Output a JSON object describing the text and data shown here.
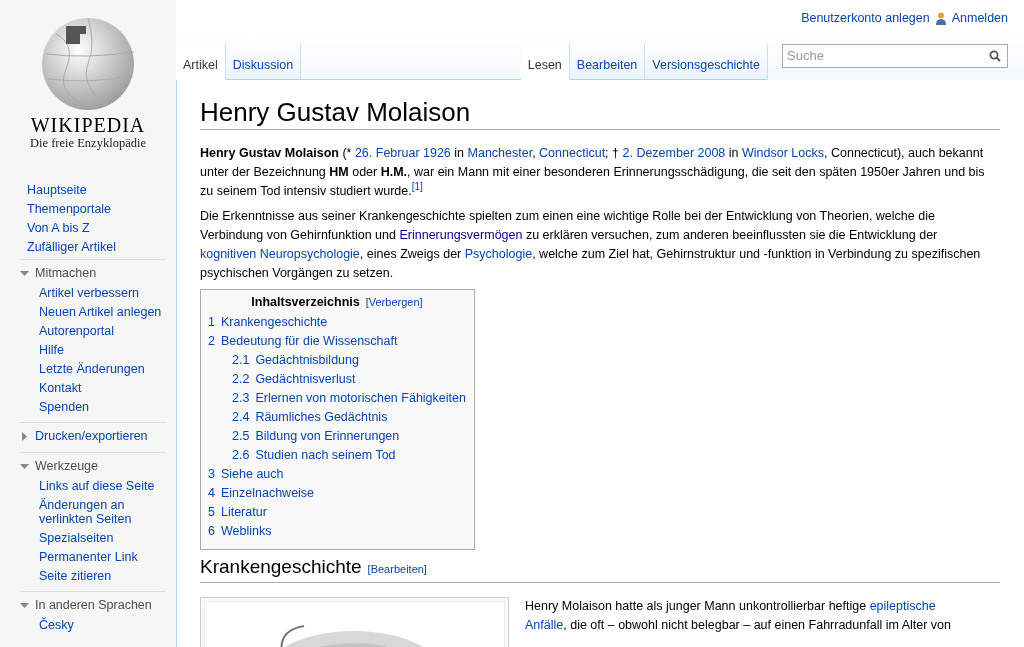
{
  "personal": {
    "create_account": "Benutzerkonto anlegen",
    "login": "Anmelden"
  },
  "logo": {
    "wordmark": "WIKIPEDIA",
    "tagline": "Die freie Enzyklopädie"
  },
  "nav": [
    "Hauptseite",
    "Themenportale",
    "Von A bis Z",
    "Zufälliger Artikel"
  ],
  "portals": [
    {
      "heading": "Mitmachen",
      "expanded": true,
      "items": [
        "Artikel verbessern",
        "Neuen Artikel anlegen",
        "Autorenportal",
        "Hilfe",
        "Letzte Änderungen",
        "Kontakt",
        "Spenden"
      ]
    },
    {
      "heading": "Drucken/exportieren",
      "expanded": false
    },
    {
      "heading": "Werkzeuge",
      "expanded": true,
      "items": [
        "Links auf diese Seite",
        "Änderungen an verlinkten Seiten",
        "Spezialseiten",
        "Permanenter Link",
        "Seite zitieren"
      ]
    },
    {
      "heading": "In anderen Sprachen",
      "expanded": true,
      "items": [
        "Česky"
      ]
    }
  ],
  "namespace_tabs": [
    {
      "label": "Artikel",
      "selected": true
    },
    {
      "label": "Diskussion",
      "selected": false
    }
  ],
  "view_tabs": [
    {
      "label": "Lesen",
      "selected": true
    },
    {
      "label": "Bearbeiten",
      "selected": false
    },
    {
      "label": "Versionsgeschichte",
      "selected": false
    }
  ],
  "search": {
    "placeholder": "Suche"
  },
  "title": "Henry Gustav Molaison",
  "paragraphs": [
    [
      {
        "kind": "bold",
        "text": "Henry Gustav Molaison"
      },
      {
        "kind": "text",
        "text": " (* "
      },
      {
        "kind": "link",
        "text": "26. Februar 1926"
      },
      {
        "kind": "text",
        "text": " in "
      },
      {
        "kind": "link",
        "text": "Manchester"
      },
      {
        "kind": "text",
        "text": ", "
      },
      {
        "kind": "link",
        "text": "Connecticut"
      },
      {
        "kind": "text",
        "text": "; † "
      },
      {
        "kind": "link",
        "text": "2. Dezember 2008"
      },
      {
        "kind": "text",
        "text": " in "
      },
      {
        "kind": "link",
        "text": "Windsor Locks"
      },
      {
        "kind": "text",
        "text": ", Connecticut), auch bekannt unter der Bezeichnung "
      },
      {
        "kind": "bold",
        "text": "HM"
      },
      {
        "kind": "text",
        "text": " oder "
      },
      {
        "kind": "bold",
        "text": "H.M."
      },
      {
        "kind": "text",
        "text": ", war ein Mann mit einer besonderen Erinnerungsschädigung, die seit den späten 1950er Jahren und bis zu seinem Tod intensiv studiert wurde."
      },
      {
        "kind": "ref",
        "text": "[1]"
      }
    ],
    [
      {
        "kind": "text",
        "text": "Die Erkenntnisse aus seiner Krankengeschichte spielten zum einen eine wichtige Rolle bei der Entwicklung von Theorien, welche die Verbindung von Gehirnfunktion und "
      },
      {
        "kind": "visited",
        "text": "Erinnerungsvermögen"
      },
      {
        "kind": "text",
        "text": " zu erklären versuchen, zum anderen beeinflussten sie die Entwicklung der "
      },
      {
        "kind": "link",
        "text": "kognitiven Neuropsychologie"
      },
      {
        "kind": "text",
        "text": ", eines Zweigs der "
      },
      {
        "kind": "link",
        "text": "Psychologie"
      },
      {
        "kind": "text",
        "text": ", welche zum Ziel hat, Gehirnstruktur und -funktion in Verbindung zu spezifischen psychischen Vorgängen zu setzen."
      }
    ]
  ],
  "toc": {
    "title": "Inhaltsverzeichnis",
    "toggle": "[Verbergen]",
    "items": [
      {
        "number": "1",
        "label": "Krankengeschichte"
      },
      {
        "number": "2",
        "label": "Bedeutung für die Wissenschaft",
        "children": [
          {
            "number": "2.1",
            "label": "Gedächtnisbildung"
          },
          {
            "number": "2.2",
            "label": "Gedächtnisverlust"
          },
          {
            "number": "2.3",
            "label": "Erlernen von motorischen Fähigkeiten"
          },
          {
            "number": "2.4",
            "label": "Räumliches Gedächtnis"
          },
          {
            "number": "2.5",
            "label": "Bildung von Erinnerungen"
          },
          {
            "number": "2.6",
            "label": "Studien nach seinem Tod"
          }
        ]
      },
      {
        "number": "3",
        "label": "Siehe auch"
      },
      {
        "number": "4",
        "label": "Einzelnachweise"
      },
      {
        "number": "5",
        "label": "Literatur"
      },
      {
        "number": "6",
        "label": "Weblinks"
      }
    ]
  },
  "section": {
    "heading": "Krankengeschichte",
    "edit": "[Bearbeiten]",
    "paragraph": [
      {
        "kind": "text",
        "text": "Henry Molaison hatte als junger Mann unkontrollierbar heftige "
      },
      {
        "kind": "wrapping_link",
        "text": "epileptische "
      },
      {
        "kind": "link",
        "text": "Anfälle"
      },
      {
        "kind": "text",
        "text": ", die oft – obwohl nicht belegbar – auf einen Fahrradunfall im Alter von"
      }
    ]
  }
}
